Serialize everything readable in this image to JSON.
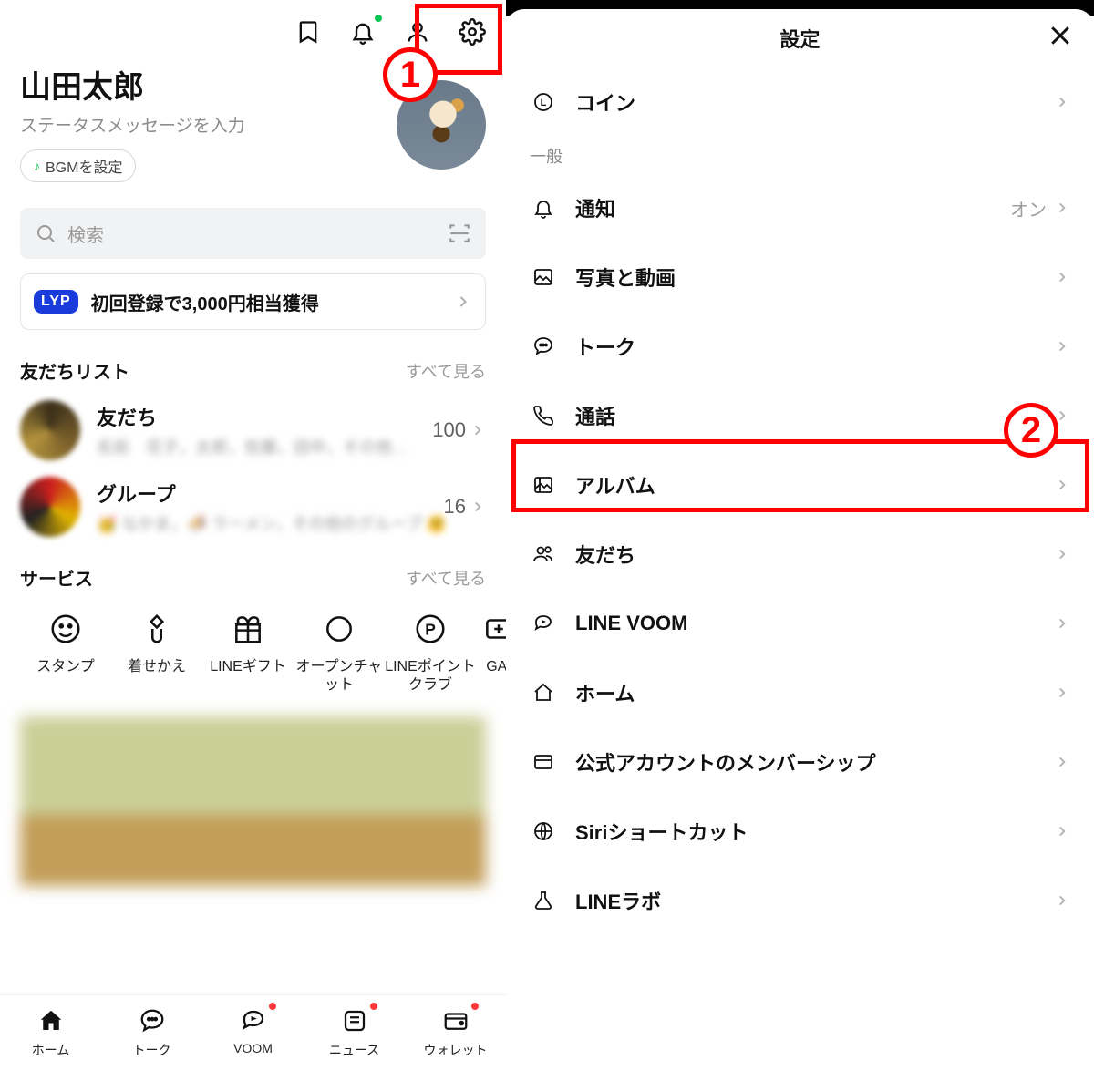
{
  "annotations": {
    "marker1": "1",
    "marker2": "2"
  },
  "home": {
    "profile": {
      "name": "山田太郎",
      "status": "ステータスメッセージを入力",
      "bgm_label": "BGMを設定"
    },
    "search": {
      "placeholder": "検索"
    },
    "lyp": {
      "badge": "LYP",
      "text": "初回登録で3,000円相当獲得"
    },
    "friends_section": {
      "title": "友だちリスト",
      "see_all": "すべて見る",
      "items": [
        {
          "title": "友だち",
          "count": "100"
        },
        {
          "title": "グループ",
          "count": "16"
        }
      ]
    },
    "services_section": {
      "title": "サービス",
      "see_all": "すべて見る",
      "items": [
        {
          "label": "スタンプ"
        },
        {
          "label": "着せかえ"
        },
        {
          "label": "LINEギフト"
        },
        {
          "label": "オープンチャット"
        },
        {
          "label": "LINEポイントクラブ"
        },
        {
          "label": "GAI"
        }
      ]
    },
    "tabs": [
      {
        "label": "ホーム"
      },
      {
        "label": "トーク"
      },
      {
        "label": "VOOM"
      },
      {
        "label": "ニュース"
      },
      {
        "label": "ウォレット"
      }
    ]
  },
  "settings": {
    "title": "設定",
    "section_general": "一般",
    "value_on": "オン",
    "rows": {
      "coin": "コイン",
      "notification": "通知",
      "photos": "写真と動画",
      "talk": "トーク",
      "call": "通話",
      "album": "アルバム",
      "friends": "友だち",
      "voom": "LINE VOOM",
      "home": "ホーム",
      "membership": "公式アカウントのメンバーシップ",
      "siri": "Siriショートカット",
      "labs": "LINEラボ"
    }
  }
}
